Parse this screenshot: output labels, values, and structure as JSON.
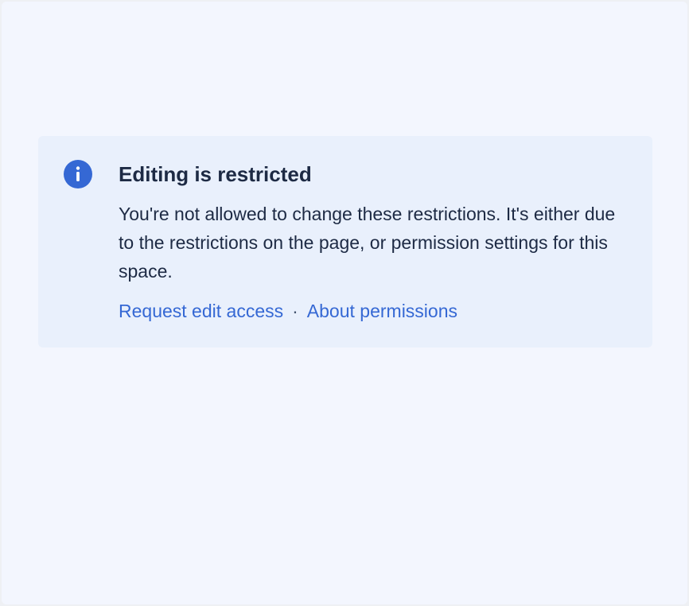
{
  "banner": {
    "icon": "info-icon",
    "accent_color": "#3568d4",
    "title": "Editing is restricted",
    "message": "You're not allowed to change these restrictions. It's either due to the restrictions on the page, or permission settings for this space.",
    "actions": {
      "request_label": "Request edit access",
      "separator": "·",
      "about_label": "About permissions"
    }
  }
}
